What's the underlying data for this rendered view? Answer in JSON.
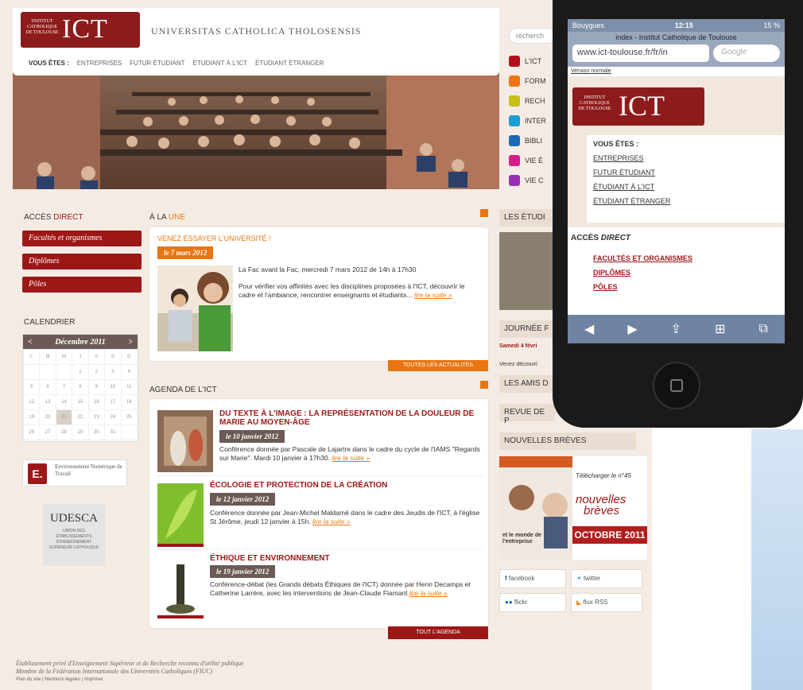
{
  "site": {
    "logo_small": "INSTITUT CATHOLIQUE DE TOULOUSE",
    "logo_big": "ICT",
    "tagline": "UNIVERSITAS CATHOLICA THOLOSENSIS",
    "nav": [
      "VOUS ÊTES :",
      "ENTREPRISES",
      "FUTUR ÉTUDIANT",
      "ÉTUDIANT À L'ICT",
      "ÉTUDIANT ÉTRANGER"
    ],
    "search_placeholder": "recherch",
    "sections": [
      {
        "label": "L'ICT",
        "color": "#b0121c"
      },
      {
        "label": "FORM",
        "color": "#ee7412"
      },
      {
        "label": "RECH",
        "color": "#c5c01a"
      },
      {
        "label": "INTER",
        "color": "#1a9fd3"
      },
      {
        "label": "BIBLI",
        "color": "#1c6ab5"
      },
      {
        "label": "VIE É",
        "color": "#d81b8a"
      },
      {
        "label": "VIE C",
        "color": "#9a2fb7"
      }
    ],
    "acces_title_a": "ACCÈS",
    "acces_title_b": "DIRECT",
    "acces_items": [
      "Facultés et organismes",
      "Diplômes",
      "Pôles"
    ],
    "calendar_title": "CALENDRIER",
    "calendar_month": "Décembre 2011",
    "calendar_prev": "<",
    "calendar_next": ">",
    "calendar_days": [
      "L",
      "M",
      "M",
      "J",
      "V",
      "S",
      "D"
    ],
    "calendar_weeks": [
      [
        "",
        "",
        "",
        "1",
        "2",
        "3",
        "4"
      ],
      [
        "5",
        "6",
        "7",
        "8",
        "9",
        "10",
        "11"
      ],
      [
        "12",
        "13",
        "14",
        "15",
        "16",
        "17",
        "18"
      ],
      [
        "19",
        "20",
        "21",
        "22",
        "23",
        "24",
        "25"
      ],
      [
        "26",
        "27",
        "28",
        "29",
        "30",
        "31",
        ""
      ]
    ],
    "ent_label": "Environnement Numérique de Travail",
    "ent_letter": "E.",
    "udesca": "UDESCA",
    "udesca_sub": "UNION DES ÉTABLISSEMENTS D'ENSEIGNEMENT SUPÉRIEUR CATHOLIQUE",
    "une_title_a": "À LA",
    "une_title_b": "UNE",
    "une_headline": "VENEZ ESSAYER L'UNIVERSITÉ !",
    "une_date": "le 7 mars 2012",
    "une_lead": "La Fac avant la Fac, mercredi 7 mars 2012 de 14h à 17h30",
    "une_body": "Pour vérifier vos affinités avec les disciplines proposées à l'ICT, découvrir le cadre et l'ambiance, rencontrer enseignants et étudiants...",
    "more_link": "lire la suite »",
    "all_news": "TOUTES LES ACTUALITÉS",
    "agenda_title": "AGENDA DE L'ICT",
    "events": [
      {
        "title": "DU TEXTE À L'IMAGE : LA REPRÉSENTATION DE LA DOULEUR DE MARIE AU MOYEN-ÂGE",
        "date": "le 10 janvier 2012",
        "body": "Conférence donnée par Pascale de Lajartre dans le cadre du cycle de l'IAMS \"Regards sur Marie\". Mardi 10 janvier à 17h30."
      },
      {
        "title": "ÉCOLOGIE ET PROTECTION DE LA CRÉATION",
        "date": "le 12 janvier 2012",
        "body": "Conférence donnée par Jean-Michel Maldamé dans le cadre des Jeudis de l'ICT, à l'église St Jérôme, jeudi 12 janvier à 15h."
      },
      {
        "title": "ÉTHIQUE ET ENVIRONNEMENT",
        "date": "le 19 janvier 2012",
        "body": "Conférence-débat (les Grands débats Éthiques de l'ICT) donnée par Henri Decamps et Catherine Larrère, avec les interventions de Jean-Claude Flamant"
      }
    ],
    "all_agenda": "TOUT L'AGENDA",
    "right_heads": [
      "LES ÉTUDI",
      "JOURNÉE F",
      "LES AMIS D",
      "REVUE DE P",
      "NOUVELLES BRÈVES"
    ],
    "journee_date": "Samedi 4 févri",
    "journee_text": "Venez découvri",
    "breves_download": "Télécharger le n°45",
    "breves_logo_a": "nouvelles",
    "breves_logo_b": "brèves",
    "breves_month": "OCTOBRE 2011",
    "breves_caption": "et le monde de l'entreprise",
    "social": [
      "facebook",
      "twitter",
      "flickr",
      "flux RSS"
    ],
    "footer_line1": "Établissement privé d'Enseignement Supérieur et de Recherche reconnu d'utilité publique",
    "footer_line2": "Membre de la Fédération Internationale des Universités Catholiques (FIUC)",
    "footer_line3": "Plan du site | Mentions légales | Imprimer"
  },
  "phone": {
    "carrier": "Bouygues",
    "time": "12:15",
    "battery": "15 %",
    "page_title": "index - Institut Catholique de Toulouse",
    "url": "www.ict-toulouse.fr/fr/in",
    "google": "Google",
    "version_link": "Version normale",
    "logo_small": "INSTITUT CATHOLIQUE DE TOULOUSE",
    "logo_big": "ICT",
    "vous_etes": "VOUS ÊTES :",
    "links": [
      "ENTREPRISES",
      "FUTUR ÉTUDIANT",
      "ÉTUDIANT À L'ICT",
      "ÉTUDIANT ÉTRANGER"
    ],
    "acces_a": "ACCÈS",
    "acces_b": "DIRECT",
    "acces_links": [
      "FACULTÉS ET ORGANISMES",
      "DIPLÔMES",
      "PÔLES"
    ],
    "toolbar": [
      "◀",
      "▶",
      "⇪",
      "⊞",
      "⧉"
    ]
  }
}
